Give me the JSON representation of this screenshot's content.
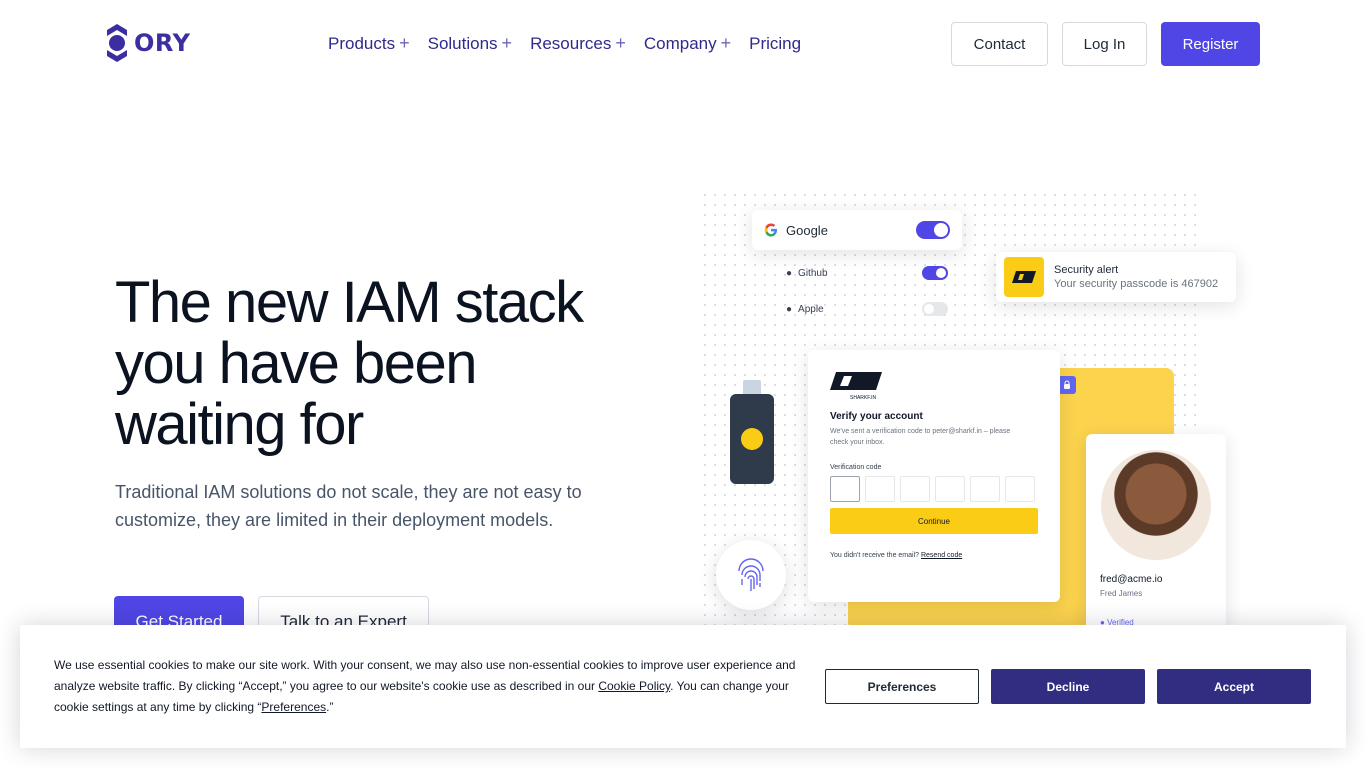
{
  "brand": {
    "name": "ORY",
    "color": "#3b2ea0"
  },
  "nav": {
    "items": [
      {
        "label": "Products",
        "expandable": true
      },
      {
        "label": "Solutions",
        "expandable": true
      },
      {
        "label": "Resources",
        "expandable": true
      },
      {
        "label": "Company",
        "expandable": true
      },
      {
        "label": "Pricing",
        "expandable": false
      }
    ],
    "contact_label": "Contact",
    "login_label": "Log In",
    "register_label": "Register",
    "accent": "#4f46e5"
  },
  "hero": {
    "title": "The new IAM stack you have been waiting for",
    "subtitle": "Traditional IAM solutions do not scale, they are not easy to customize, they are limited in their deployment models.",
    "cta_primary": "Get Started",
    "cta_secondary": "Talk to an Expert"
  },
  "illustration": {
    "providers": [
      {
        "label": "Google",
        "enabled": true
      },
      {
        "label": "Github",
        "enabled": true
      },
      {
        "label": "Apple",
        "enabled": false
      }
    ],
    "alert": {
      "title": "Security alert",
      "text": "Your security passcode is 467902"
    },
    "verify": {
      "brand": "SHARKF.IN",
      "title": "Verify your account",
      "text": "We've sent a verification code to peter@sharkf.in – please check your inbox.",
      "code_label": "Verification code",
      "continue_label": "Continue",
      "resend_prefix": "You didn't receive the email?",
      "resend_link": "Resend code"
    },
    "profile": {
      "email": "fred@acme.io",
      "name": "Fred James",
      "status": "Verified"
    }
  },
  "cookie": {
    "text_1": "We use essential cookies to make our site work. With your consent, we may also use non-essential cookies to improve user experience and analyze website traffic. By clicking “Accept,” you agree to our website's cookie use as described in our ",
    "policy_link": "Cookie Policy",
    "text_2": ". You can change your cookie settings at any time by clicking “",
    "preferences_link": "Preferences",
    "text_3": ".”",
    "preferences_button": "Preferences",
    "decline_button": "Decline",
    "accept_button": "Accept"
  }
}
